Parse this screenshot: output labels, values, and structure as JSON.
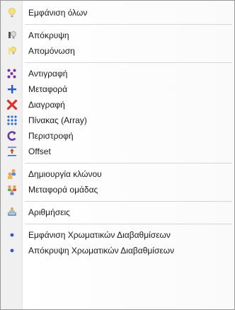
{
  "menu": {
    "items": [
      {
        "label": "Εμφάνιση όλων",
        "icon": "bulb-icon"
      },
      {
        "label": "Απόκρυψη",
        "icon": "hide-bulb-icon"
      },
      {
        "label": "Απομόνωση",
        "icon": "isolate-bulb-icon"
      },
      {
        "label": "Αντιγραφή",
        "icon": "copy-dots-icon"
      },
      {
        "label": "Μεταφορά",
        "icon": "move-cross-icon"
      },
      {
        "label": "Διαγραφή",
        "icon": "delete-x-icon"
      },
      {
        "label": "Πίνακας (Array)",
        "icon": "array-grid-icon"
      },
      {
        "label": "Περιστροφή",
        "icon": "rotate-icon"
      },
      {
        "label": "Offset",
        "icon": "offset-icon"
      },
      {
        "label": "Δημιουργία κλώνου",
        "icon": "clone-icon"
      },
      {
        "label": "Μεταφορά ομάδας",
        "icon": "group-move-icon"
      },
      {
        "label": "Αριθμήσεις",
        "icon": "numbering-icon"
      },
      {
        "label": "Εμφάνιση Χρωματικών Διαβαθμίσεων",
        "icon": "bullet-icon"
      },
      {
        "label": "Απόκρυψη Χρωματικών Διαβαθμίσεων",
        "icon": "bullet-icon"
      }
    ]
  },
  "colors": {
    "accent_blue": "#2a57d6",
    "delete_red": "#e0302a",
    "bulb_yellow": "#f7e27a"
  }
}
